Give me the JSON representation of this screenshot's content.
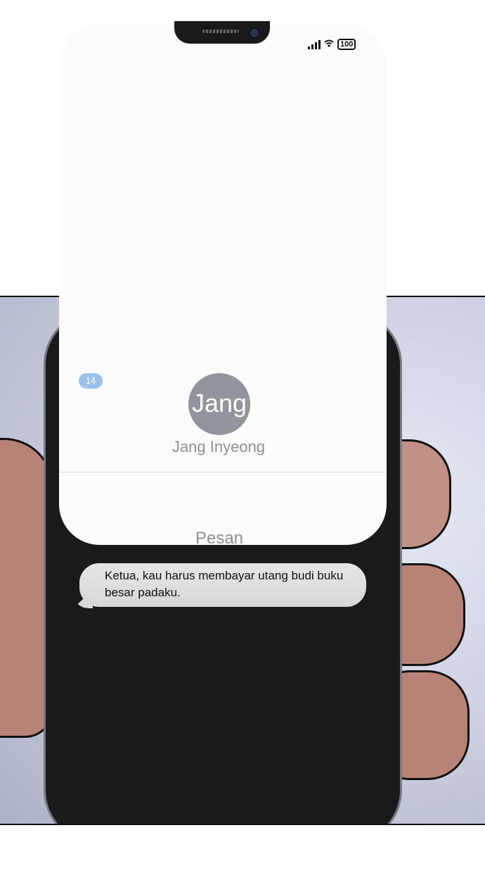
{
  "status_bar": {
    "battery": "100"
  },
  "back": {
    "badge": "14"
  },
  "contact": {
    "avatar_text": "Jang",
    "name": "Jang Inyeong"
  },
  "thread": {
    "service_label": "Pesan"
  },
  "message": {
    "text": "Ketua, kau harus membayar utang budi buku besar padaku."
  }
}
